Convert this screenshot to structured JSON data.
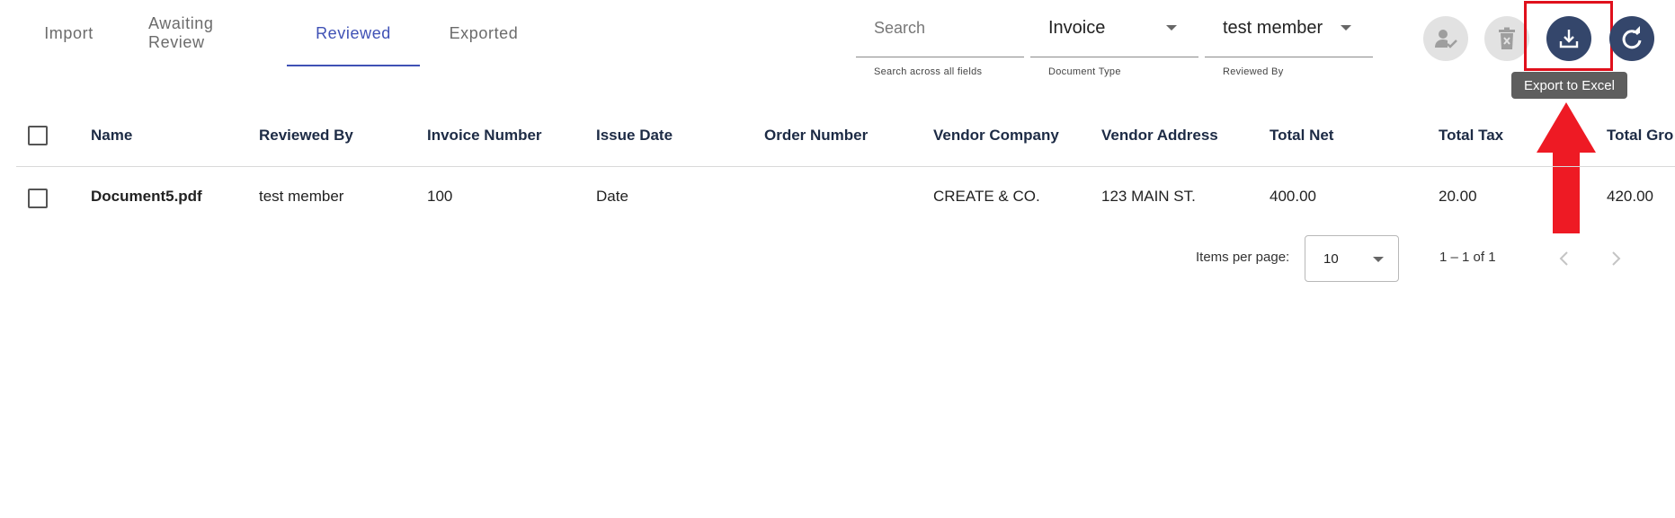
{
  "tabs": [
    {
      "label": "Import"
    },
    {
      "label": "Awaiting Review"
    },
    {
      "label": "Reviewed"
    },
    {
      "label": "Exported"
    }
  ],
  "active_tab": "Reviewed",
  "filters": {
    "search": {
      "placeholder": "Search",
      "hint": "Search across all fields"
    },
    "document_type": {
      "value": "Invoice",
      "hint": "Document Type"
    },
    "reviewed_by": {
      "value": "test member",
      "hint": "Reviewed By"
    }
  },
  "actions": {
    "assign_icon": "person-check-icon",
    "delete_icon": "delete-icon",
    "export_icon": "download-icon",
    "refresh_icon": "refresh-icon",
    "export_tooltip": "Export to Excel"
  },
  "table": {
    "columns": [
      "Name",
      "Reviewed By",
      "Invoice Number",
      "Issue Date",
      "Order Number",
      "Vendor Company",
      "Vendor Address",
      "Total Net",
      "Total Tax",
      "Total Gro"
    ],
    "rows": [
      [
        "Document5.pdf",
        "test member",
        "100",
        "Date",
        "",
        "CREATE & CO.",
        "123 MAIN ST.",
        "400.00",
        "20.00",
        "420.00"
      ]
    ]
  },
  "pagination": {
    "items_per_page_label": "Items per page:",
    "page_size": "10",
    "range": "1 – 1 of 1"
  },
  "colors": {
    "accent": "#3f51b5",
    "primary_button": "#34466b",
    "annotation": "#e0101c"
  }
}
